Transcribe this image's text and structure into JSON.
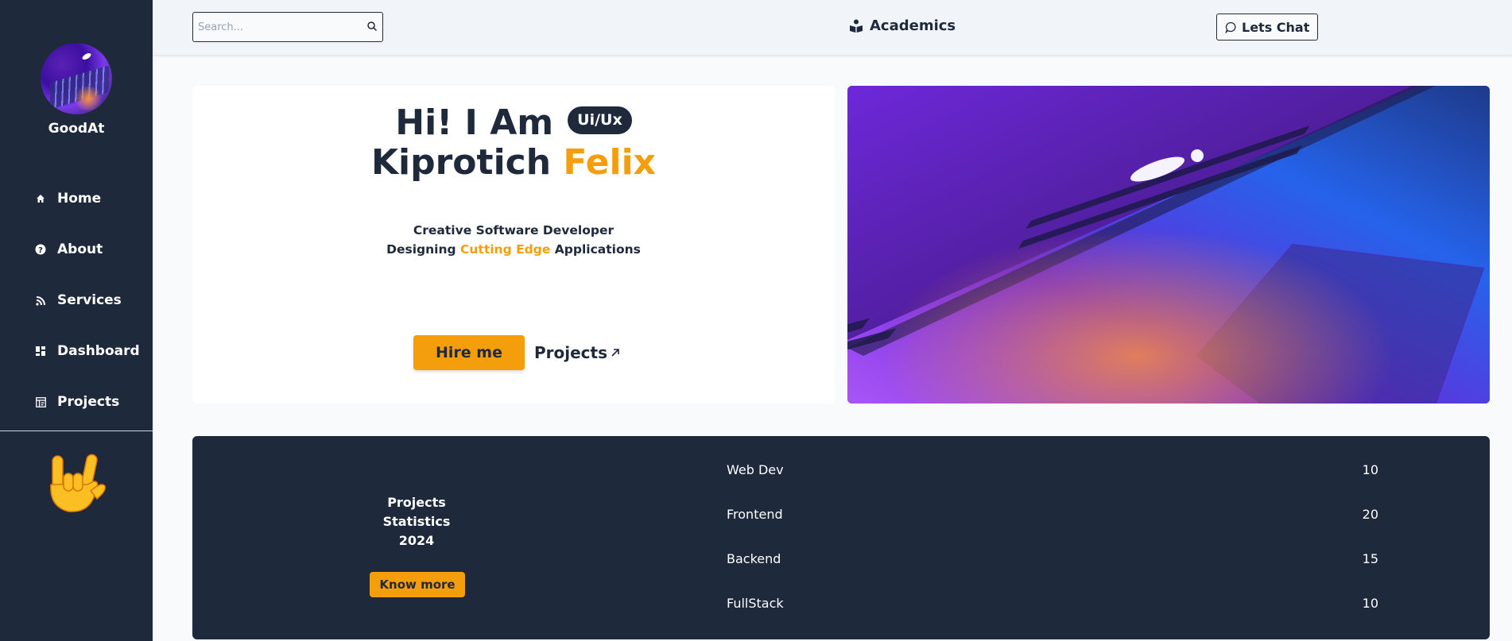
{
  "sidebar": {
    "brand": "GoodAt",
    "items": [
      {
        "label": "Home",
        "icon": "home-icon"
      },
      {
        "label": "About",
        "icon": "question-icon"
      },
      {
        "label": "Services",
        "icon": "signal-icon"
      },
      {
        "label": "Dashboard",
        "icon": "dashboard-icon"
      },
      {
        "label": "Projects",
        "icon": "projects-icon"
      }
    ],
    "bottom_emoji": "🤟"
  },
  "topbar": {
    "search_placeholder": "Search...",
    "center_label": "Academics",
    "chat_label": "Lets Chat"
  },
  "hero": {
    "greeting": "Hi! I Am",
    "badge": "Ui/Ux",
    "first_name": "Kiprotich",
    "last_name": "Felix",
    "subtitle_line1": "Creative Software Developer",
    "subtitle_pre": "Designing",
    "subtitle_accent": "Cutting Edge",
    "subtitle_post": "Applications",
    "hire_label": "Hire me",
    "projects_label": "Projects"
  },
  "stats": {
    "title_line1": "Projects",
    "title_line2": "Statistics",
    "title_line3": "2024",
    "button_label": "Know more",
    "rows": [
      {
        "label": "Web Dev",
        "value": "10"
      },
      {
        "label": "Frontend",
        "value": "20"
      },
      {
        "label": "Backend",
        "value": "15"
      },
      {
        "label": "FullStack",
        "value": "10"
      }
    ]
  },
  "colors": {
    "sidebar_bg": "#1e293b",
    "accent": "#f59e0b",
    "page_bg": "#f8fafc"
  }
}
